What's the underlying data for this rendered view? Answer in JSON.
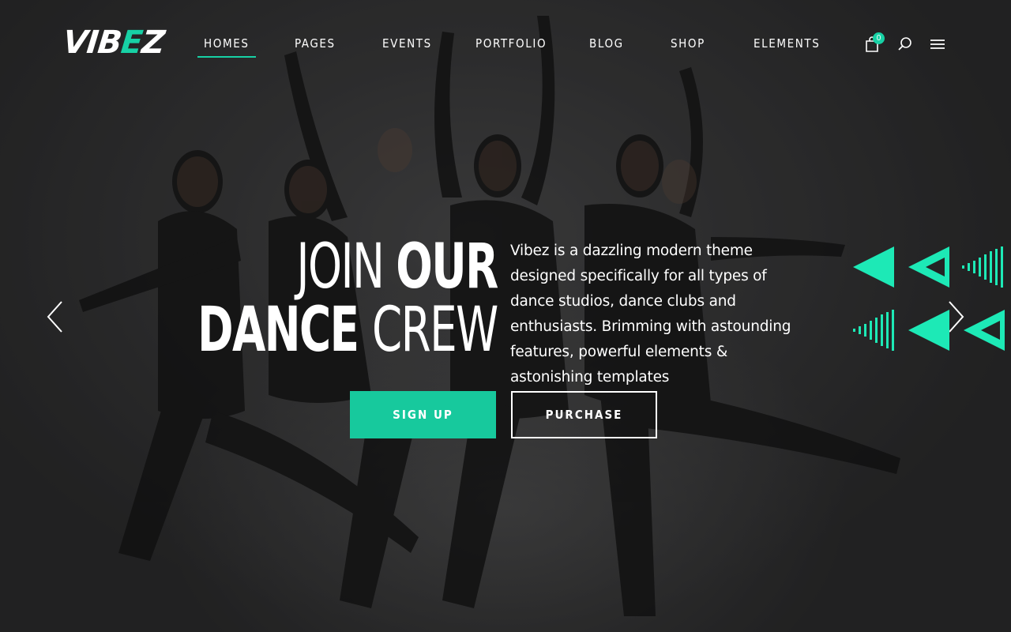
{
  "brand": {
    "logo_prefix": "VIB",
    "logo_accent": "E",
    "logo_suffix": "Z",
    "accent_color": "#17d1a5"
  },
  "nav": {
    "items": [
      {
        "label": "HOMES",
        "active": true
      },
      {
        "label": "PAGES"
      },
      {
        "label": "EVENTS"
      },
      {
        "label": "PORTFOLIO"
      },
      {
        "label": "BLOG"
      },
      {
        "label": "SHOP"
      },
      {
        "label": "ELEMENTS"
      }
    ],
    "cart_count": "0",
    "icons": [
      "shopping-bag-icon",
      "search-icon",
      "hamburger-menu-icon"
    ]
  },
  "hero": {
    "headline_line1_thin": "JOIN ",
    "headline_line1_bold": "OUR",
    "headline_line2_bold": "DANCE ",
    "headline_line2_thin": "CREW",
    "description": "Vibez is a dazzling modern theme designed specifically for all types of dance studios, dance clubs and enthusiasts. Brimming with astounding features, powerful elements & astonishing templates",
    "signup_label": "SIGN UP",
    "purchase_label": "PURCHASE",
    "prev_icon": "chevron-left-icon",
    "next_icon": "chevron-right-icon",
    "button_color": "#17c99d"
  }
}
